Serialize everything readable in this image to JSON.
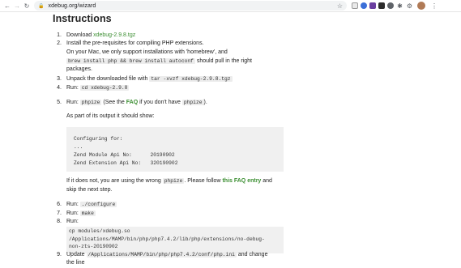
{
  "browser": {
    "url": "xdebug.org/wizard"
  },
  "page": {
    "heading": "Instructions",
    "step1": {
      "num": "1.",
      "text": "Download ",
      "link": "xdebug-2.9.8.tgz"
    },
    "step2": {
      "num": "2.",
      "line1": "Install the pre-requisites for compiling PHP extensions.",
      "line2": "On your Mac, we only support installations with 'homebrew', and",
      "code": "brew install php && brew install autoconf",
      "line3_after": " should pull in the right",
      "line4": "packages."
    },
    "step3": {
      "num": "3.",
      "text": "Unpack the downloaded file with ",
      "code": "tar -xvzf xdebug-2.9.8.tgz"
    },
    "step4": {
      "num": "4.",
      "text": "Run: ",
      "code": "cd xdebug-2.9.8"
    },
    "step5": {
      "num": "5.",
      "text": "Run: ",
      "code": "phpize",
      "mid": " (See the ",
      "faq": "FAQ",
      "after": " if you don't have ",
      "code2": "phpize",
      "end": ").",
      "output_intro": "As part of its output it should show:",
      "output": "Configuring for:\n...\nZend Module Api No:      20190902\nZend Extension Api No:   320190902",
      "wrong_before": "If it does not, you are using the wrong ",
      "wrong_code": "phpize",
      "wrong_mid": ". Please follow ",
      "wrong_link": "this FAQ entry",
      "wrong_after": " and",
      "wrong_line2": "skip the next step."
    },
    "step6": {
      "num": "6.",
      "text": "Run: ",
      "code": "./configure"
    },
    "step7": {
      "num": "7.",
      "text": "Run: ",
      "code": "make"
    },
    "step8": {
      "num": "8.",
      "text": "Run:",
      "block": "cp modules/xdebug.so\n/Applications/MAMP/bin/php/php7.4.2/lib/php/extensions/no-debug-\nnon-zts-20190902"
    },
    "step9": {
      "num": "9.",
      "text": "Update ",
      "code": "/Applications/MAMP/bin/php/php7.4.2/conf/php.ini",
      "after": " and change",
      "line2": "the line"
    }
  }
}
